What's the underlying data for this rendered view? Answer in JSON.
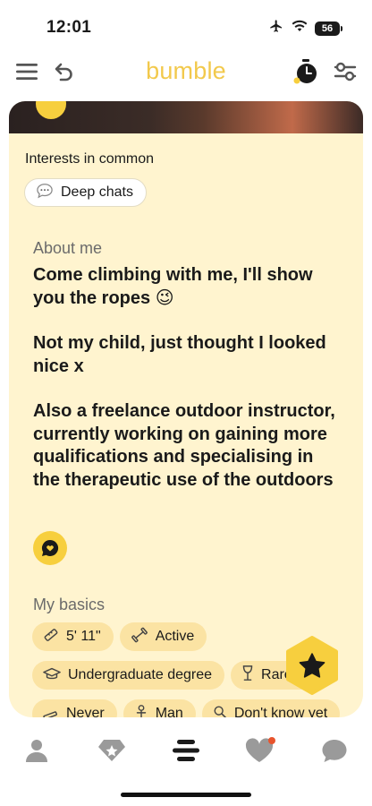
{
  "status_bar": {
    "time": "12:01",
    "battery": "56"
  },
  "top_nav": {
    "logo": "bumble",
    "icons": [
      "menu-icon",
      "undo-icon",
      "timer-icon",
      "filter-icon"
    ]
  },
  "profile": {
    "interests_title": "Interests in common",
    "interests": [
      {
        "icon": "speech-bubble-icon",
        "label": "Deep chats"
      }
    ],
    "about_label": "About me",
    "about_paragraphs": [
      "Come climbing with me, I'll show you the ropes 😉",
      "Not my child, just thought I looked nice x",
      "Also a freelance outdoor instructor, currently working on gaining more qualifications and specialising in the therapeutic use of the outdoors"
    ],
    "basics_label": "My basics",
    "basics": [
      {
        "icon": "ruler-icon",
        "label": "5' 11\""
      },
      {
        "icon": "dumbbell-icon",
        "label": "Active"
      },
      {
        "icon": "graduation-cap-icon",
        "label": "Undergraduate degree"
      },
      {
        "icon": "wine-glass-icon",
        "label": "Rarely"
      },
      {
        "icon": "smoking-icon",
        "label": "Never"
      },
      {
        "icon": "gender-icon",
        "label": "Man"
      },
      {
        "icon": "search-icon",
        "label": "Don't know yet"
      }
    ]
  },
  "bottom_nav": {
    "tabs": [
      "profile-tab",
      "discover-tab",
      "people-tab",
      "liked-you-tab",
      "chats-tab"
    ],
    "active": "people-tab"
  },
  "colors": {
    "brand": "#f2c94c",
    "card_bg": "#fff4cf",
    "chip_bg": "#fbe3a3",
    "badge": "#f7cf3e",
    "notification": "#e8542d"
  }
}
